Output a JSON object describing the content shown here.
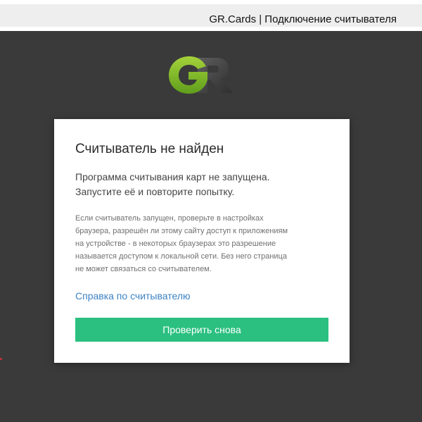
{
  "window": {
    "title": "GR.Cards | Подключение считывателя"
  },
  "logo": {
    "icon": "gr-logo-icon",
    "text": "GR",
    "colors": {
      "g_light": "#a5d23a",
      "g_dark": "#5f9e1c",
      "r_light": "#5e5e5e",
      "r_dark": "#2e2e2e"
    }
  },
  "dialog": {
    "title": "Считыватель не найден",
    "message_lines": [
      "Программа считывания карт не запущена.",
      "Запустите её и повторите попытку."
    ],
    "note_lines": [
      "Если считыватель запущен, проверьте в настройках",
      "браузера, разрешён ли этому сайту доступ к приложениям",
      "на устройстве - в некоторых браузерах это разрешение",
      "называется доступом к локальной сети. Без него страница",
      "не может связаться со считывателем."
    ],
    "help_link": "Справка по считывателю",
    "retry_button": "Проверить снова"
  },
  "colors": {
    "background": "#3a3a3a",
    "accent_green": "#2bc080",
    "link_blue": "#3d82c4"
  }
}
